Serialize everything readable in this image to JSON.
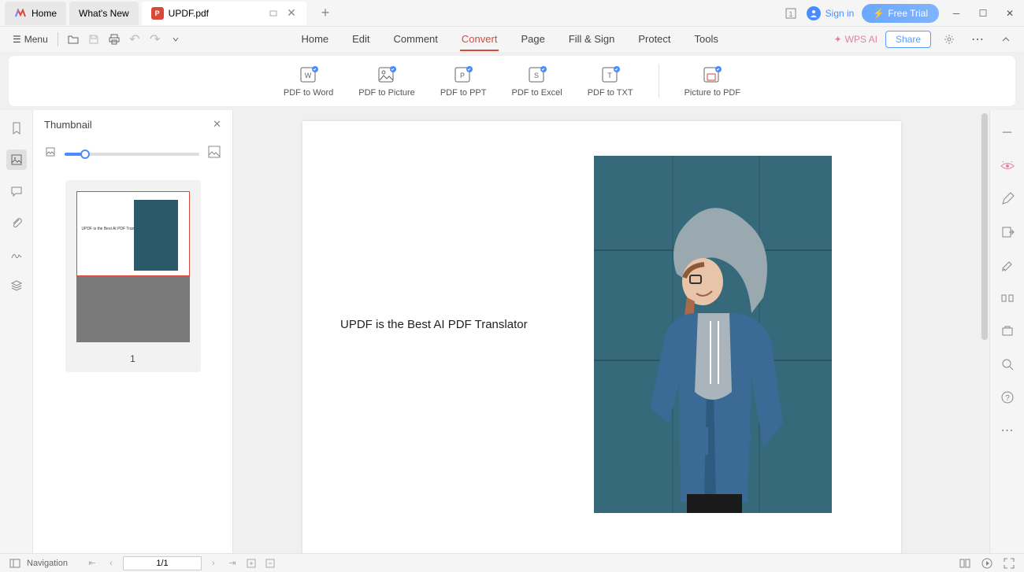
{
  "titlebar": {
    "tabs": {
      "home": "Home",
      "whats_new": "What's New",
      "file": "UPDF.pdf"
    },
    "signin": "Sign in",
    "freetrial": "Free Trial"
  },
  "menubar": {
    "menu": "Menu",
    "items": {
      "home": "Home",
      "edit": "Edit",
      "comment": "Comment",
      "convert": "Convert",
      "page": "Page",
      "fillsign": "Fill & Sign",
      "protect": "Protect",
      "tools": "Tools"
    },
    "wpsai": "WPS AI",
    "share": "Share"
  },
  "ribbon": {
    "pdf_word": "PDF to Word",
    "pdf_picture": "PDF to Picture",
    "pdf_ppt": "PDF to PPT",
    "pdf_excel": "PDF to Excel",
    "pdf_txt": "PDF to TXT",
    "picture_pdf": "Picture to PDF"
  },
  "thumbnail": {
    "title": "Thumbnail",
    "page_num": "1"
  },
  "document": {
    "text": "UPDF is the Best AI PDF Translator"
  },
  "statusbar": {
    "navigation": "Navigation",
    "page": "1/1"
  }
}
